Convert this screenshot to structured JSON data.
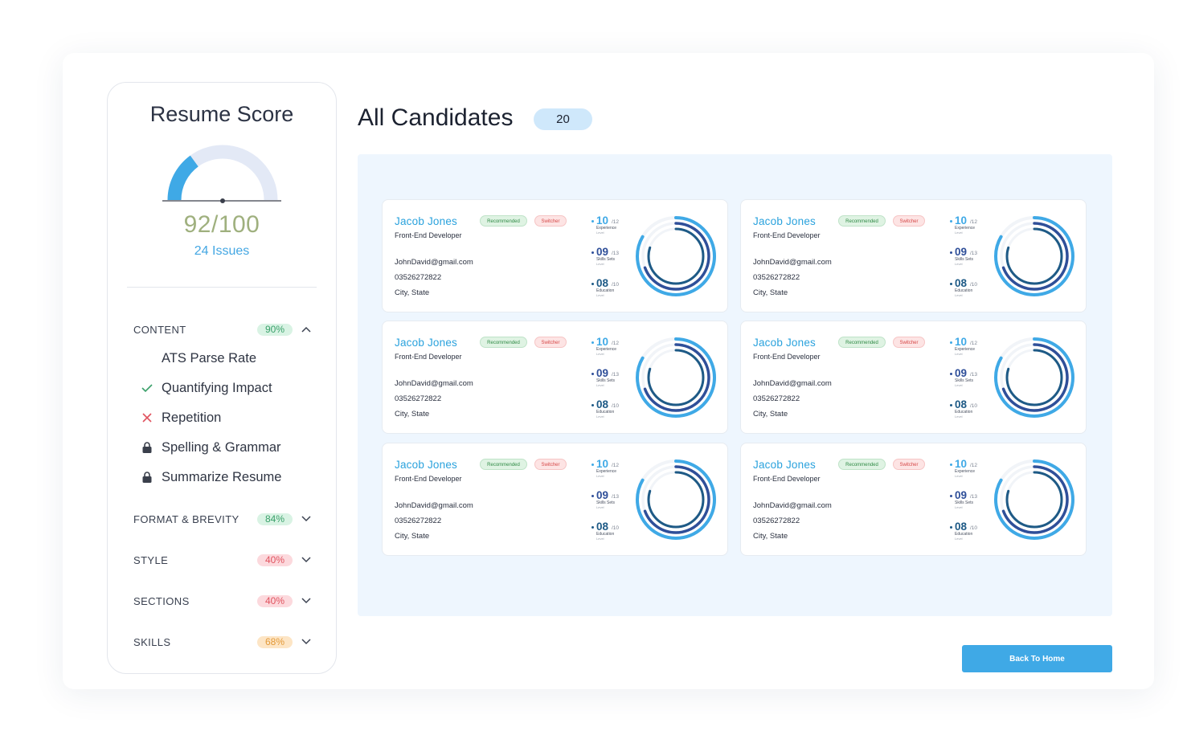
{
  "score_panel": {
    "title": "Resume Score",
    "score": "92/100",
    "issues": "24 Issues",
    "gauge_fraction": 0.3,
    "categories": [
      {
        "label": "CONTENT",
        "percent": "90%",
        "expanded": true,
        "badge_bg": "#d9f3e4",
        "badge_color": "#3aa06a",
        "items": [
          {
            "label": "ATS Parse Rate",
            "icon": "none"
          },
          {
            "label": "Quantifying Impact",
            "icon": "check-icon"
          },
          {
            "label": "Repetition",
            "icon": "cross-icon"
          },
          {
            "label": "Spelling & Grammar",
            "icon": "lock-icon"
          },
          {
            "label": "Summarize Resume",
            "icon": "lock-icon"
          }
        ]
      },
      {
        "label": "FORMAT & BREVITY",
        "percent": "84%",
        "expanded": false,
        "badge_bg": "#d9f3e4",
        "badge_color": "#3aa06a"
      },
      {
        "label": "STYLE",
        "percent": "40%",
        "expanded": false,
        "badge_bg": "#fcd9dd",
        "badge_color": "#e0535f"
      },
      {
        "label": "SECTIONS",
        "percent": "40%",
        "expanded": false,
        "badge_bg": "#fcd9dd",
        "badge_color": "#e0535f"
      },
      {
        "label": "SKILLS",
        "percent": "68%",
        "expanded": false,
        "badge_bg": "#fde5c5",
        "badge_color": "#e39a3a"
      }
    ]
  },
  "main": {
    "title": "All Candidates",
    "count": "20",
    "back_button": "Back To Home"
  },
  "colors": {
    "accent": "#3fa9e6",
    "ring_light": "#3fa9e6",
    "ring_mid": "#2f4f99",
    "ring_dark": "#1e5a86"
  },
  "candidates": [
    {
      "name": "Jacob Jones",
      "role": "Front-End Developer",
      "tag_recommended": "Recommended",
      "tag_switcher": "Switcher",
      "email": "JohnDavid@gmail.com",
      "phone": "03526272822",
      "location": "City, State",
      "stats": [
        {
          "value": "10",
          "max": "/12",
          "label": "Experience",
          "sublabel": "Level"
        },
        {
          "value": "09",
          "max": "/13",
          "label": "Skills Sets",
          "sublabel": "Level"
        },
        {
          "value": "08",
          "max": "/10",
          "label": "Education",
          "sublabel": "Level"
        }
      ]
    },
    {
      "name": "Jacob Jones",
      "role": "Front-End Developer",
      "tag_recommended": "Recommended",
      "tag_switcher": "Switcher",
      "email": "JohnDavid@gmail.com",
      "phone": "03526272822",
      "location": "City, State",
      "stats": [
        {
          "value": "10",
          "max": "/12",
          "label": "Experience",
          "sublabel": "Level"
        },
        {
          "value": "09",
          "max": "/13",
          "label": "Skills Sets",
          "sublabel": "Level"
        },
        {
          "value": "08",
          "max": "/10",
          "label": "Education",
          "sublabel": "Level"
        }
      ]
    },
    {
      "name": "Jacob Jones",
      "role": "Front-End Developer",
      "tag_recommended": "Recommended",
      "tag_switcher": "Switcher",
      "email": "JohnDavid@gmail.com",
      "phone": "03526272822",
      "location": "City, State",
      "stats": [
        {
          "value": "10",
          "max": "/12",
          "label": "Experience",
          "sublabel": "Level"
        },
        {
          "value": "09",
          "max": "/13",
          "label": "Skills Sets",
          "sublabel": "Level"
        },
        {
          "value": "08",
          "max": "/10",
          "label": "Education",
          "sublabel": "Level"
        }
      ]
    },
    {
      "name": "Jacob Jones",
      "role": "Front-End Developer",
      "tag_recommended": "Recommended",
      "tag_switcher": "Switcher",
      "email": "JohnDavid@gmail.com",
      "phone": "03526272822",
      "location": "City, State",
      "stats": [
        {
          "value": "10",
          "max": "/12",
          "label": "Experience",
          "sublabel": "Level"
        },
        {
          "value": "09",
          "max": "/13",
          "label": "Skills Sets",
          "sublabel": "Level"
        },
        {
          "value": "08",
          "max": "/10",
          "label": "Education",
          "sublabel": "Level"
        }
      ]
    },
    {
      "name": "Jacob Jones",
      "role": "Front-End Developer",
      "tag_recommended": "Recommended",
      "tag_switcher": "Switcher",
      "email": "JohnDavid@gmail.com",
      "phone": "03526272822",
      "location": "City, State",
      "stats": [
        {
          "value": "10",
          "max": "/12",
          "label": "Experience",
          "sublabel": "Level"
        },
        {
          "value": "09",
          "max": "/13",
          "label": "Skills Sets",
          "sublabel": "Level"
        },
        {
          "value": "08",
          "max": "/10",
          "label": "Education",
          "sublabel": "Level"
        }
      ]
    },
    {
      "name": "Jacob Jones",
      "role": "Front-End Developer",
      "tag_recommended": "Recommended",
      "tag_switcher": "Switcher",
      "email": "JohnDavid@gmail.com",
      "phone": "03526272822",
      "location": "City, State",
      "stats": [
        {
          "value": "10",
          "max": "/12",
          "label": "Experience",
          "sublabel": "Level"
        },
        {
          "value": "09",
          "max": "/13",
          "label": "Skills Sets",
          "sublabel": "Level"
        },
        {
          "value": "08",
          "max": "/10",
          "label": "Education",
          "sublabel": "Level"
        }
      ]
    }
  ]
}
